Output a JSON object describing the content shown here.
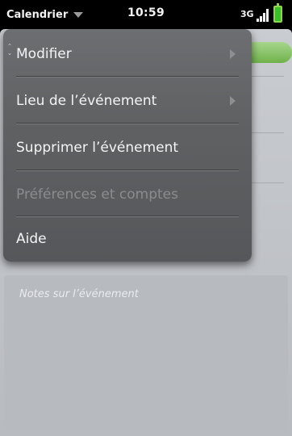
{
  "status_bar": {
    "app_name": "Calendrier",
    "time": "10:59",
    "network": "3G"
  },
  "background": {
    "notes_placeholder": "Notes sur l’événement"
  },
  "menu": {
    "items": [
      {
        "label": "Modifier",
        "has_submenu": true,
        "enabled": true
      },
      {
        "label": "Lieu de l’événement",
        "has_submenu": true,
        "enabled": true
      },
      {
        "label": "Supprimer l’événement",
        "has_submenu": false,
        "enabled": true
      },
      {
        "label": "Préférences et comptes",
        "has_submenu": false,
        "enabled": false
      },
      {
        "label": "Aide",
        "has_submenu": false,
        "enabled": true
      }
    ]
  },
  "colors": {
    "battery": "#38c02a",
    "header_button": "#7fbf5a",
    "menu_bg": "#5f6163"
  }
}
